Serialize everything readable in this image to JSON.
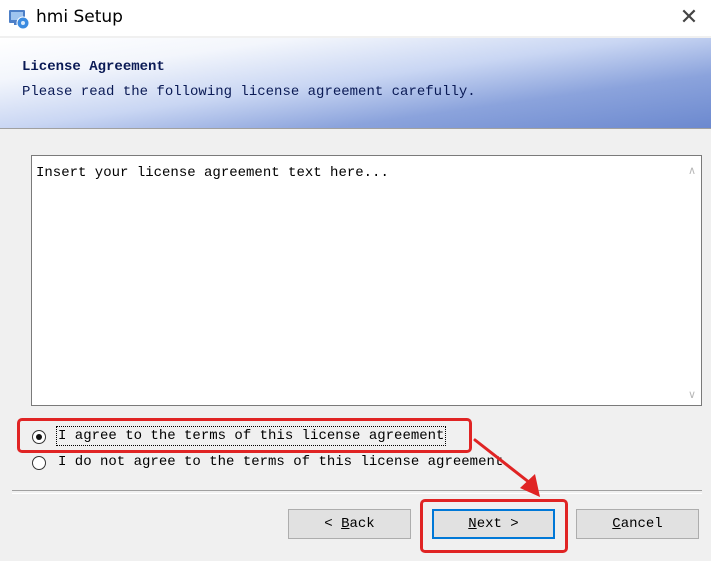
{
  "window": {
    "title": "hmi Setup",
    "close_glyph": "✕"
  },
  "header": {
    "title": "License Agreement",
    "subtitle": "Please read the following license agreement carefully."
  },
  "license": {
    "text": "Insert your license agreement text here..."
  },
  "options": [
    {
      "label": "I agree to the terms of this license agreement",
      "selected": true
    },
    {
      "label": "I do not agree to the terms of this license agreement",
      "selected": false
    }
  ],
  "buttons": {
    "back": {
      "prefix": "< ",
      "mnemonic": "B",
      "rest": "ack"
    },
    "next": {
      "mnemonic": "N",
      "rest": "ext",
      "suffix": " >"
    },
    "cancel": {
      "mnemonic": "C",
      "rest": "ancel"
    }
  },
  "icons": {
    "app": "installer-icon",
    "scroll_up": "chevron-up-icon",
    "scroll_down": "chevron-down-icon"
  },
  "colors": {
    "highlight": "#e02424",
    "focus_blue": "#0078d7",
    "header_blue": "#6c89cf"
  }
}
